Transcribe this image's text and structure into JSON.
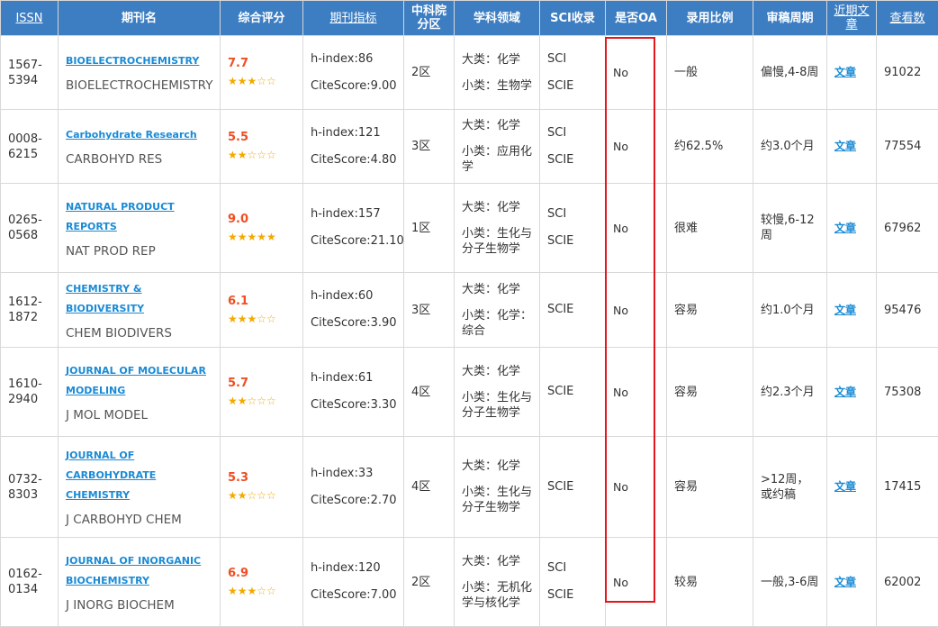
{
  "headers": {
    "issn": "ISSN",
    "name": "期刊名",
    "score": "综合评分",
    "metric": "期刊指标",
    "cas_zone": "中科院分区",
    "subject": "学科领域",
    "sci": "SCI收录",
    "oa": "是否OA",
    "accept": "录用比例",
    "review": "审稿周期",
    "recent": "近期文章",
    "views": "查看数"
  },
  "rows": [
    {
      "issn": "1567-5394",
      "name_lines": [
        "BIOELECTROCHEMISTRY"
      ],
      "abbr": "BIOELECTROCHEMISTRY",
      "score": "7.7",
      "stars": "★★★☆☆",
      "hindex": "h-index:86",
      "citescore": "CiteScore:9.00",
      "zone": "2区",
      "big": "大类：化学",
      "small": "小类：生物学",
      "sci": [
        "SCI",
        "SCIE"
      ],
      "oa": "No",
      "accept": "一般",
      "review": "偏慢,4-8周",
      "recent": "文章",
      "views": "91022"
    },
    {
      "issn": "0008-6215",
      "name_lines": [
        "Carbohydrate Research"
      ],
      "abbr": "CARBOHYD RES",
      "score": "5.5",
      "stars": "★★☆☆☆",
      "hindex": "h-index:121",
      "citescore": "CiteScore:4.80",
      "zone": "3区",
      "big": "大类：化学",
      "small": "小类：应用化学",
      "sci": [
        "SCI",
        "SCIE"
      ],
      "oa": "No",
      "accept": "约62.5%",
      "review": "约3.0个月",
      "recent": "文章",
      "views": "77554"
    },
    {
      "issn": "0265-0568",
      "name_lines": [
        "NATURAL PRODUCT",
        "REPORTS"
      ],
      "abbr": "NAT PROD REP",
      "score": "9.0",
      "stars": "★★★★★",
      "hindex": "h-index:157",
      "citescore": "CiteScore:21.10",
      "zone": "1区",
      "big": "大类：化学",
      "small": "小类：生化与分子生物学",
      "sci": [
        "SCI",
        "SCIE"
      ],
      "oa": "No",
      "accept": "很难",
      "review": "较慢,6-12周",
      "recent": "文章",
      "views": "67962"
    },
    {
      "issn": "1612-1872",
      "name_lines": [
        "CHEMISTRY & BIODIVERSITY"
      ],
      "abbr": "CHEM BIODIVERS",
      "score": "6.1",
      "stars": "★★★☆☆",
      "hindex": "h-index:60",
      "citescore": "CiteScore:3.90",
      "zone": "3区",
      "big": "大类：化学",
      "small": "小类：化学：综合",
      "sci": [
        "SCIE"
      ],
      "oa": "No",
      "accept": "容易",
      "review": "约1.0个月",
      "recent": "文章",
      "views": "95476"
    },
    {
      "issn": "1610-2940",
      "name_lines": [
        "JOURNAL OF MOLECULAR",
        "MODELING"
      ],
      "abbr": "J MOL MODEL",
      "score": "5.7",
      "stars": "★★☆☆☆",
      "hindex": "h-index:61",
      "citescore": "CiteScore:3.30",
      "zone": "4区",
      "big": "大类：化学",
      "small": "小类：生化与分子生物学",
      "sci": [
        "SCIE"
      ],
      "oa": "No",
      "accept": "容易",
      "review": "约2.3个月",
      "recent": "文章",
      "views": "75308"
    },
    {
      "issn": "0732-8303",
      "name_lines": [
        "JOURNAL OF",
        "CARBOHYDRATE",
        "CHEMISTRY"
      ],
      "abbr": "J CARBOHYD CHEM",
      "score": "5.3",
      "stars": "★★☆☆☆",
      "hindex": "h-index:33",
      "citescore": "CiteScore:2.70",
      "zone": "4区",
      "big": "大类：化学",
      "small": "小类：生化与分子生物学",
      "sci": [
        "SCIE"
      ],
      "oa": "No",
      "accept": "容易",
      "review": ">12周，或约稿",
      "recent": "文章",
      "views": "17415"
    },
    {
      "issn": "0162-0134",
      "name_lines": [
        "JOURNAL OF INORGANIC",
        "BIOCHEMISTRY"
      ],
      "abbr": "J INORG BIOCHEM",
      "score": "6.9",
      "stars": "★★★☆☆",
      "hindex": "h-index:120",
      "citescore": "CiteScore:7.00",
      "zone": "2区",
      "big": "大类：化学",
      "small": "小类：无机化学与核化学",
      "sci": [
        "SCI",
        "SCIE"
      ],
      "oa": "No",
      "accept": "较易",
      "review": "一般,3-6周",
      "recent": "文章",
      "views": "62002"
    }
  ],
  "highlight": {
    "column": "oa",
    "color": "#e2161b"
  }
}
